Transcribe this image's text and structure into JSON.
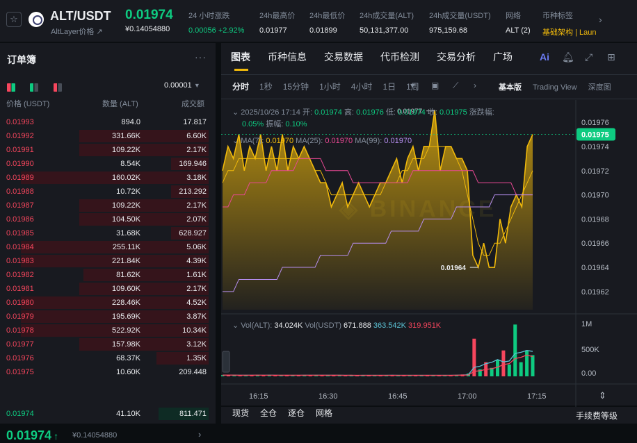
{
  "header": {
    "pair": "ALT/USDT",
    "pair_sub": "AltLayer价格",
    "pair_sub_arrow": "↗",
    "price": "0.01974",
    "price_sub": "¥0.14054880",
    "stats": [
      {
        "label": "24 小时涨跌",
        "value": "0.00056 +2.92%",
        "x": 271,
        "cls": "green"
      },
      {
        "label": "24h最高价",
        "value": "0.01977",
        "x": 373,
        "cls": ""
      },
      {
        "label": "24h最低价",
        "value": "0.01899",
        "x": 445,
        "cls": ""
      },
      {
        "label": "24h成交量(ALT)",
        "value": "50,131,377.00",
        "x": 517,
        "cls": ""
      },
      {
        "label": "24h成交量(USDT)",
        "value": "975,159.68",
        "x": 617,
        "cls": ""
      },
      {
        "label": "网络",
        "value": "ALT (2)",
        "x": 727,
        "cls": ""
      },
      {
        "label": "币种标签",
        "value": "基础架构 | Laun",
        "x": 780,
        "cls": "yellow"
      }
    ]
  },
  "orderbook": {
    "title": "订单簿",
    "precision": "0.00001",
    "headers": {
      "price": "价格 (USDT)",
      "qty": "数量 (ALT)",
      "total": "成交额"
    },
    "asks": [
      {
        "price": "0.01993",
        "qty": "894.0",
        "total": "17.817",
        "depth": 0.0
      },
      {
        "price": "0.01992",
        "qty": "331.66K",
        "total": "6.60K",
        "depth": 0.62
      },
      {
        "price": "0.01991",
        "qty": "109.22K",
        "total": "2.17K",
        "depth": 0.62
      },
      {
        "price": "0.01990",
        "qty": "8.54K",
        "total": "169.946",
        "depth": 0.18
      },
      {
        "price": "0.01989",
        "qty": "160.02K",
        "total": "3.18K",
        "depth": 0.9
      },
      {
        "price": "0.01988",
        "qty": "10.72K",
        "total": "213.292",
        "depth": 0.18
      },
      {
        "price": "0.01987",
        "qty": "109.22K",
        "total": "2.17K",
        "depth": 0.62
      },
      {
        "price": "0.01986",
        "qty": "104.50K",
        "total": "2.07K",
        "depth": 0.62
      },
      {
        "price": "0.01985",
        "qty": "31.68K",
        "total": "628.927",
        "depth": 0.18
      },
      {
        "price": "0.01984",
        "qty": "255.11K",
        "total": "5.06K",
        "depth": 0.9
      },
      {
        "price": "0.01983",
        "qty": "221.84K",
        "total": "4.39K",
        "depth": 0.9
      },
      {
        "price": "0.01982",
        "qty": "81.62K",
        "total": "1.61K",
        "depth": 0.6
      },
      {
        "price": "0.01981",
        "qty": "109.60K",
        "total": "2.17K",
        "depth": 0.62
      },
      {
        "price": "0.01980",
        "qty": "228.46K",
        "total": "4.52K",
        "depth": 0.9
      },
      {
        "price": "0.01979",
        "qty": "195.69K",
        "total": "3.87K",
        "depth": 0.9
      },
      {
        "price": "0.01978",
        "qty": "522.92K",
        "total": "10.34K",
        "depth": 0.9
      },
      {
        "price": "0.01977",
        "qty": "157.98K",
        "total": "3.12K",
        "depth": 0.62
      },
      {
        "price": "0.01976",
        "qty": "68.37K",
        "total": "1.35K",
        "depth": 0.25
      },
      {
        "price": "0.01975",
        "qty": "10.60K",
        "total": "209.448",
        "depth": 0.0
      }
    ],
    "last_price": "0.01974",
    "last_arrow": "↑",
    "last_sub": "¥0.14054880",
    "bid": {
      "price": "0.01974",
      "qty": "41.10K",
      "total": "811.471",
      "depth": 0.24
    }
  },
  "chart_panel": {
    "tabs": [
      "图表",
      "币种信息",
      "交易数据",
      "代币检测",
      "交易分析",
      "广场"
    ],
    "intervals": [
      "分时",
      "1秒",
      "15分钟",
      "1小时",
      "4小时",
      "1日",
      "1周"
    ],
    "views": [
      "基本版",
      "Trading View",
      "深度图"
    ],
    "ohlc": {
      "date": "2025/10/26 17:14",
      "open_l": "开:",
      "open": "0.01974",
      "high_l": "高:",
      "high": "0.01976",
      "low_l": "低:",
      "low": "0.01974",
      "close_l": "收:",
      "close": "0.01975",
      "chg_l": "涨跌幅:",
      "chg": "0.05%",
      "amp_l": "振幅:",
      "amp": "0.10%"
    },
    "ma": {
      "ma7_l": "MA(7):",
      "ma7": "0.01970",
      "ma25_l": "MA(25):",
      "ma25": "0.01970",
      "ma99_l": "MA(99):",
      "ma99": "0.01970"
    },
    "vol": {
      "alt_l": "Vol(ALT):",
      "alt": "34.024K",
      "usdt_l": "Vol(USDT)",
      "usdt": "671.888",
      "v1": "363.542K",
      "v2": "319.951K"
    },
    "bottom_tabs": [
      "现货",
      "全仓",
      "逐仓",
      "网格"
    ],
    "fee_label": "手续费等级"
  },
  "chart_data": {
    "type": "area",
    "x_ticks": [
      "16:15",
      "16:30",
      "16:45",
      "17:00",
      "17:15"
    ],
    "y_ticks": [
      "0.01976",
      "0.01974",
      "0.01972",
      "0.01970",
      "0.01968",
      "0.01966",
      "0.01964",
      "0.01962"
    ],
    "ylim": [
      0.019605,
      0.019775
    ],
    "vol_ticks": [
      "1M",
      "500K",
      "0.00"
    ],
    "current_price": "0.01975",
    "high_label": "0.01977",
    "low_label": "0.01964",
    "price": [
      0.01972,
      0.01974,
      0.01973,
      0.01975,
      0.01972,
      0.01974,
      0.01973,
      0.01975,
      0.01972,
      0.01974,
      0.01972,
      0.01975,
      0.01972,
      0.01974,
      0.01973,
      0.01974,
      0.01973,
      0.01972,
      0.01971,
      0.01971,
      0.01969,
      0.0197,
      0.01971,
      0.01969,
      0.0197,
      0.01971,
      0.0197,
      0.01969,
      0.0197,
      0.01971,
      0.01971,
      0.01972,
      0.01973,
      0.01971,
      0.01973,
      0.01974,
      0.01972,
      0.01974,
      0.01974,
      0.01977,
      0.01972,
      0.01974,
      0.01974,
      0.01973,
      0.01973,
      0.01972,
      0.01965,
      0.01964,
      0.01966,
      0.01964,
      0.01964,
      0.01968,
      0.01966,
      0.01969,
      0.0197,
      0.01969,
      0.01974,
      0.01975
    ],
    "ma7": [
      0.01971,
      0.01972,
      0.01972,
      0.01973,
      0.01973,
      0.01973,
      0.01973,
      0.01973,
      0.01973,
      0.01973,
      0.01973,
      0.01973,
      0.01973,
      0.01973,
      0.01973,
      0.01973,
      0.01973,
      0.01972,
      0.01972,
      0.01971,
      0.0197,
      0.0197,
      0.0197,
      0.0197,
      0.0197,
      0.0197,
      0.0197,
      0.0197,
      0.0197,
      0.0197,
      0.01971,
      0.01971,
      0.01971,
      0.01972,
      0.01972,
      0.01973,
      0.01973,
      0.01973,
      0.01974,
      0.01974,
      0.01974,
      0.01974,
      0.01974,
      0.01973,
      0.01972,
      0.0197,
      0.01968,
      0.01966,
      0.01965,
      0.01965,
      0.01966,
      0.01966,
      0.01967,
      0.01968,
      0.01969,
      0.0197,
      0.01971,
      0.01972
    ],
    "ma25": [
      0.01969,
      0.01969,
      0.0197,
      0.0197,
      0.0197,
      0.01971,
      0.01971,
      0.01971,
      0.01971,
      0.01972,
      0.01972,
      0.01972,
      0.01972,
      0.01972,
      0.01973,
      0.01973,
      0.01973,
      0.01973,
      0.01973,
      0.01972,
      0.01972,
      0.01972,
      0.01972,
      0.01972,
      0.01971,
      0.01971,
      0.01971,
      0.01971,
      0.01971,
      0.01971,
      0.01971,
      0.01971,
      0.01971,
      0.01971,
      0.01971,
      0.01972,
      0.01972,
      0.01972,
      0.01972,
      0.01972,
      0.01972,
      0.01972,
      0.01972,
      0.01972,
      0.01972,
      0.01972,
      0.01972,
      0.01971,
      0.01971,
      0.01971,
      0.01971,
      0.01971,
      0.01971,
      0.01971,
      0.0197,
      0.0197,
      0.0197,
      0.0197
    ],
    "ma99": [
      0.01962,
      0.01962,
      0.01962,
      0.01963,
      0.01963,
      0.01963,
      0.01963,
      0.01963,
      0.01963,
      0.01963,
      0.01963,
      0.01964,
      0.01964,
      0.01964,
      0.01964,
      0.01964,
      0.01964,
      0.01964,
      0.01965,
      0.01965,
      0.01965,
      0.01965,
      0.01965,
      0.01965,
      0.01966,
      0.01966,
      0.01966,
      0.01966,
      0.01966,
      0.01966,
      0.01966,
      0.01967,
      0.01967,
      0.01967,
      0.01967,
      0.01967,
      0.01967,
      0.01968,
      0.01968,
      0.01968,
      0.01968,
      0.01968,
      0.01968,
      0.01969,
      0.01969,
      0.01969,
      0.01969,
      0.01969,
      0.01969,
      0.01969,
      0.0197,
      0.0197,
      0.0197,
      0.0197,
      0.0197,
      0.0197,
      0.0197,
      0.0197
    ],
    "volume": [
      25,
      30,
      20,
      18,
      22,
      28,
      30,
      20,
      25,
      15,
      22,
      30,
      18,
      25,
      20,
      25,
      30,
      22,
      20,
      18,
      25,
      20,
      22,
      18,
      20,
      25,
      22,
      20,
      25,
      22,
      18,
      20,
      25,
      22,
      20,
      18,
      25,
      22,
      20,
      25,
      30,
      40,
      60,
      800,
      150,
      300,
      180,
      350,
      550,
      250,
      1100,
      300,
      550,
      450
    ],
    "vol_up": [
      1,
      0,
      1,
      0,
      1,
      0,
      1,
      0,
      1,
      0,
      1,
      0,
      1,
      0,
      1,
      0,
      1,
      0,
      1,
      0,
      1,
      0,
      1,
      0,
      1,
      0,
      1,
      0,
      1,
      0,
      1,
      0,
      1,
      0,
      1,
      0,
      1,
      0,
      1,
      0,
      1,
      0,
      1,
      0,
      1,
      0,
      1,
      1,
      0,
      1,
      1,
      1,
      1,
      1
    ]
  }
}
